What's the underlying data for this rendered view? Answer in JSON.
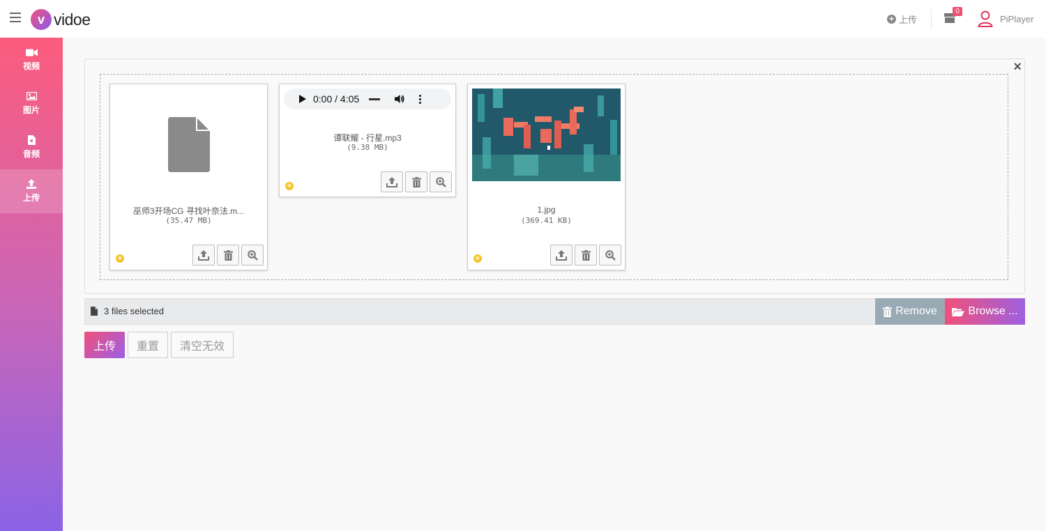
{
  "header": {
    "logo_letter": "v",
    "logo_text": "vidoe",
    "upload_label": "上传",
    "cart_badge": "0",
    "username": "PiPlayer"
  },
  "sidebar": {
    "items": [
      {
        "label": "视频",
        "icon": "video-camera-icon"
      },
      {
        "label": "图片",
        "icon": "image-icon"
      },
      {
        "label": "音频",
        "icon": "audio-file-icon"
      },
      {
        "label": "上传",
        "icon": "upload-icon",
        "active": true
      }
    ]
  },
  "uploader": {
    "close_symbol": "×",
    "files": [
      {
        "name": "巫师3开场CG 寻找叶奈法.m...",
        "size": "(35.47 MB)",
        "type": "generic-file"
      },
      {
        "name": "谭联耀 - 行星.mp3",
        "size": "(9.38 MB)",
        "type": "audio",
        "player_time": "0:00 / 4:05"
      },
      {
        "name": "1.jpg",
        "size": "(369.41 KB)",
        "type": "image"
      }
    ],
    "status_text": "3 files selected",
    "remove_label": "Remove",
    "browse_label": "Browse ..."
  },
  "buttons": {
    "upload": "上传",
    "reset": "重置",
    "clear_invalid": "清空无效"
  },
  "colors": {
    "brand_gradient_start": "#fc5c7d",
    "brand_gradient_end": "#8b63e6",
    "badge": "#f0506e",
    "remove_bg": "#9aaab5",
    "add_dot": "#f4c430"
  }
}
